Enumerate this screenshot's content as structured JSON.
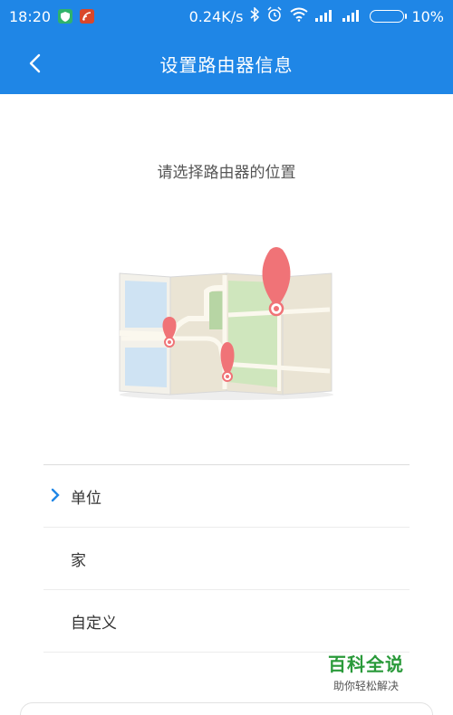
{
  "status_bar": {
    "time": "18:20",
    "speed": "0.24K/s",
    "battery": "10%",
    "icons": [
      "shield-icon",
      "wifi-signal-icon",
      "bluetooth-icon",
      "alarm-icon",
      "wifi-icon",
      "signal-icon",
      "signal-icon",
      "battery-icon"
    ]
  },
  "header": {
    "title": "设置路由器信息",
    "back_icon": "chevron-left-icon"
  },
  "main": {
    "prompt": "请选择路由器的位置",
    "options": [
      {
        "label": "单位",
        "selected": true
      },
      {
        "label": "家",
        "selected": false
      },
      {
        "label": "自定义",
        "selected": false
      }
    ]
  },
  "watermark": {
    "title": "百科全说",
    "subtitle": "助你轻松解决"
  },
  "colors": {
    "primary": "#1f86e6",
    "pin": "#f07377",
    "watermark": "#2a9a3a"
  }
}
